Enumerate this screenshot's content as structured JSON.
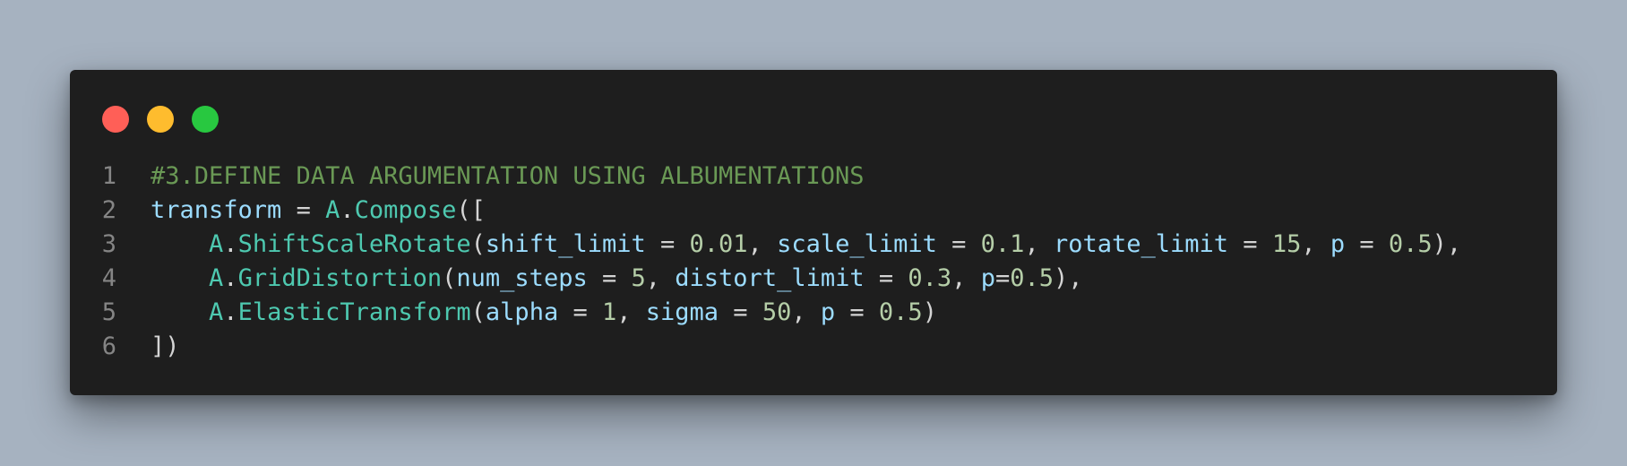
{
  "window": {
    "controls": [
      {
        "name": "close",
        "color": "#ff5f57"
      },
      {
        "name": "minimize",
        "color": "#febc2e"
      },
      {
        "name": "maximize",
        "color": "#28c840"
      }
    ]
  },
  "colors": {
    "background": "#a6b2c0",
    "editor": "#1e1e1e",
    "comment": "#6a9955",
    "variable": "#9cdcfe",
    "class": "#4ec9b0",
    "number": "#b5cea8",
    "punctuation": "#d4d4d4",
    "line_number": "#858585"
  },
  "code": {
    "lines": [
      {
        "number": "1",
        "tokens": [
          {
            "t": "#3.DEFINE DATA ARGUMENTATION USING ALBUMENTATIONS",
            "k": "comment"
          }
        ]
      },
      {
        "number": "2",
        "tokens": [
          {
            "t": "transform",
            "k": "var"
          },
          {
            "t": " = ",
            "k": "punc"
          },
          {
            "t": "A",
            "k": "class"
          },
          {
            "t": ".",
            "k": "punc"
          },
          {
            "t": "Compose",
            "k": "class"
          },
          {
            "t": "([",
            "k": "punc"
          }
        ]
      },
      {
        "number": "3",
        "tokens": [
          {
            "t": "    ",
            "k": "punc"
          },
          {
            "t": "A",
            "k": "class"
          },
          {
            "t": ".",
            "k": "punc"
          },
          {
            "t": "ShiftScaleRotate",
            "k": "class"
          },
          {
            "t": "(",
            "k": "punc"
          },
          {
            "t": "shift_limit",
            "k": "var"
          },
          {
            "t": " = ",
            "k": "punc"
          },
          {
            "t": "0.01",
            "k": "num"
          },
          {
            "t": ", ",
            "k": "punc"
          },
          {
            "t": "scale_limit",
            "k": "var"
          },
          {
            "t": " = ",
            "k": "punc"
          },
          {
            "t": "0.1",
            "k": "num"
          },
          {
            "t": ", ",
            "k": "punc"
          },
          {
            "t": "rotate_limit",
            "k": "var"
          },
          {
            "t": " = ",
            "k": "punc"
          },
          {
            "t": "15",
            "k": "num"
          },
          {
            "t": ", ",
            "k": "punc"
          },
          {
            "t": "p",
            "k": "var"
          },
          {
            "t": " = ",
            "k": "punc"
          },
          {
            "t": "0.5",
            "k": "num"
          },
          {
            "t": "),",
            "k": "punc"
          }
        ]
      },
      {
        "number": "4",
        "tokens": [
          {
            "t": "    ",
            "k": "punc"
          },
          {
            "t": "A",
            "k": "class"
          },
          {
            "t": ".",
            "k": "punc"
          },
          {
            "t": "GridDistortion",
            "k": "class"
          },
          {
            "t": "(",
            "k": "punc"
          },
          {
            "t": "num_steps",
            "k": "var"
          },
          {
            "t": " = ",
            "k": "punc"
          },
          {
            "t": "5",
            "k": "num"
          },
          {
            "t": ", ",
            "k": "punc"
          },
          {
            "t": "distort_limit",
            "k": "var"
          },
          {
            "t": " = ",
            "k": "punc"
          },
          {
            "t": "0.3",
            "k": "num"
          },
          {
            "t": ", ",
            "k": "punc"
          },
          {
            "t": "p",
            "k": "var"
          },
          {
            "t": "=",
            "k": "punc"
          },
          {
            "t": "0.5",
            "k": "num"
          },
          {
            "t": "),",
            "k": "punc"
          }
        ]
      },
      {
        "number": "5",
        "tokens": [
          {
            "t": "    ",
            "k": "punc"
          },
          {
            "t": "A",
            "k": "class"
          },
          {
            "t": ".",
            "k": "punc"
          },
          {
            "t": "ElasticTransform",
            "k": "class"
          },
          {
            "t": "(",
            "k": "punc"
          },
          {
            "t": "alpha",
            "k": "var"
          },
          {
            "t": " = ",
            "k": "punc"
          },
          {
            "t": "1",
            "k": "num"
          },
          {
            "t": ", ",
            "k": "punc"
          },
          {
            "t": "sigma",
            "k": "var"
          },
          {
            "t": " = ",
            "k": "punc"
          },
          {
            "t": "50",
            "k": "num"
          },
          {
            "t": ", ",
            "k": "punc"
          },
          {
            "t": "p",
            "k": "var"
          },
          {
            "t": " = ",
            "k": "punc"
          },
          {
            "t": "0.5",
            "k": "num"
          },
          {
            "t": ")",
            "k": "punc"
          }
        ]
      },
      {
        "number": "6",
        "tokens": [
          {
            "t": "])",
            "k": "punc"
          }
        ]
      }
    ]
  }
}
